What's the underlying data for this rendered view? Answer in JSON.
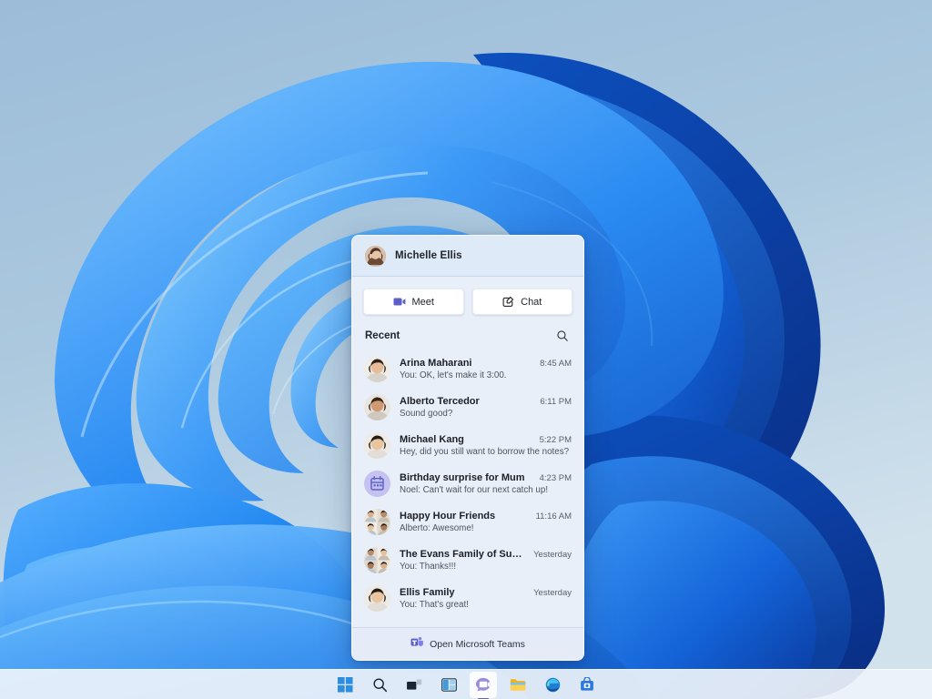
{
  "desktop": {
    "wallpaper_name": "windows-11-bloom-wallpaper",
    "background_top_color": "#9dbdd8",
    "background_bottom_color": "#cfe0ec",
    "ribbon_light_color": "#3f9cf8",
    "ribbon_mid_color": "#1473e6",
    "ribbon_dark_color": "#0b47b5"
  },
  "chat_panel": {
    "header": {
      "user_name": "Michelle Ellis",
      "avatar_name": "user-avatar"
    },
    "actions": [
      {
        "label": "Meet",
        "icon": "video-camera-icon",
        "icon_color": "#5b5fc7"
      },
      {
        "label": "Chat",
        "icon": "compose-message-icon",
        "icon_color": "#242424"
      }
    ],
    "recent": {
      "label": "Recent",
      "search_icon": "search-icon"
    },
    "chats": [
      {
        "title": "Arina Maharani",
        "preview": "You: OK, let's make it 3:00.",
        "time": "8:45 AM",
        "avatar_type": "photo",
        "avatar_name": "avatar-arina-maharani"
      },
      {
        "title": "Alberto Tercedor",
        "preview": "Sound good?",
        "time": "6:11 PM",
        "avatar_type": "photo",
        "avatar_name": "avatar-alberto-tercedor"
      },
      {
        "title": "Michael Kang",
        "preview": "Hey, did you still want to borrow the notes?",
        "time": "5:22 PM",
        "avatar_type": "photo",
        "avatar_name": "avatar-michael-kang"
      },
      {
        "title": "Birthday surprise for Mum",
        "preview": "Noel: Can't wait for our next catch up!",
        "time": "4:23 PM",
        "avatar_type": "icon",
        "avatar_name": "calendar-group-icon",
        "avatar_bg": "#c5c1f0"
      },
      {
        "title": "Happy Hour Friends",
        "preview": "Alberto: Awesome!",
        "time": "11:16 AM",
        "avatar_type": "collage",
        "avatar_name": "avatar-happy-hour-friends"
      },
      {
        "title": "The Evans Family of Supers",
        "preview": "You: Thanks!!!",
        "time": "Yesterday",
        "avatar_type": "collage",
        "avatar_name": "avatar-evans-family"
      },
      {
        "title": "Ellis Family",
        "preview": "You: That's great!",
        "time": "Yesterday",
        "avatar_type": "photo",
        "avatar_name": "avatar-ellis-family"
      }
    ],
    "footer": {
      "label": "Open Microsoft Teams",
      "icon": "microsoft-teams-icon"
    }
  },
  "taskbar": {
    "items": [
      {
        "name": "start-button",
        "icon": "windows-start-icon",
        "active": false
      },
      {
        "name": "search-button",
        "icon": "search-icon",
        "active": false
      },
      {
        "name": "task-view-button",
        "icon": "task-view-icon",
        "active": false
      },
      {
        "name": "widgets-button",
        "icon": "widgets-icon",
        "active": false
      },
      {
        "name": "chat-button",
        "icon": "chat-teams-icon",
        "active": true
      },
      {
        "name": "file-explorer-button",
        "icon": "file-explorer-icon",
        "active": false
      },
      {
        "name": "edge-button",
        "icon": "microsoft-edge-icon",
        "active": false
      },
      {
        "name": "microsoft-store-button",
        "icon": "microsoft-store-icon",
        "active": false
      }
    ]
  }
}
